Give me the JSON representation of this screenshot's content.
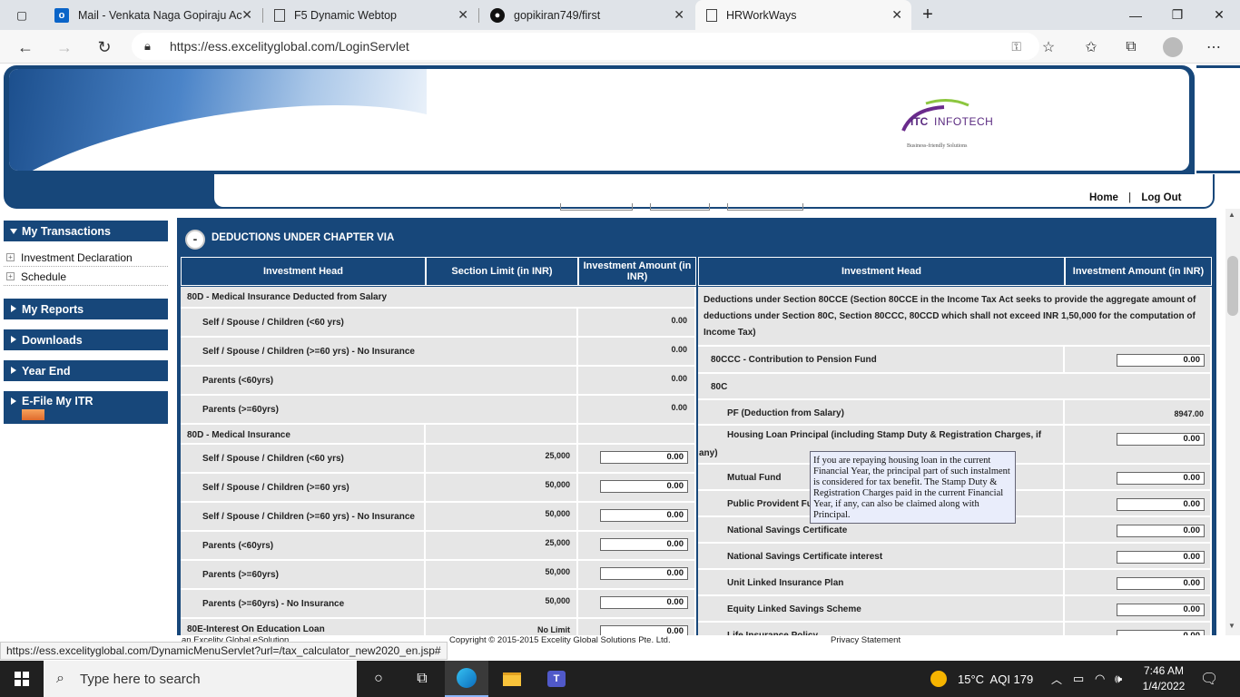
{
  "browser": {
    "tabs": [
      {
        "title": "Mail - Venkata Naga Gopiraju Ac",
        "icon": "outlook-icon"
      },
      {
        "title": "F5 Dynamic Webtop",
        "icon": "page-icon"
      },
      {
        "title": "gopikiran749/first",
        "icon": "github-icon"
      },
      {
        "title": "HRWorkWays",
        "icon": "page-icon"
      }
    ],
    "url": "https://ess.excelityglobal.com/LoginServlet"
  },
  "header": {
    "logo_text": "ITC INFOTECH",
    "logo_tagline": "Business-friendly Solutions",
    "home_link": "Home",
    "separator": "|",
    "logout_link": "Log Out"
  },
  "sidebar": {
    "my_transactions": "My Transactions",
    "investment_declaration": "Investment Declaration",
    "schedule": "Schedule",
    "my_reports": "My Reports",
    "downloads": "Downloads",
    "year_end": "Year End",
    "efile": "E-File My ITR"
  },
  "section": {
    "title": "DEDUCTIONS UNDER CHAPTER VIA",
    "left_headers": [
      "Investment Head",
      "Section Limit (in INR)",
      "Investment Amount (in INR)"
    ],
    "right_headers": [
      "Investment Head",
      "Investment Amount (in INR)"
    ],
    "left_rows": [
      {
        "label": "80D - Medical Insurance Deducted from Salary",
        "limit": "",
        "amount": ""
      },
      {
        "label": "Self / Spouse / Children (<60 yrs)",
        "limit": "",
        "amount": "0.00"
      },
      {
        "label": "Self / Spouse / Children (>=60 yrs) - No Insurance",
        "limit": "",
        "amount": "0.00"
      },
      {
        "label": "Parents (<60yrs)",
        "limit": "",
        "amount": "0.00"
      },
      {
        "label": "Parents (>=60yrs)",
        "limit": "",
        "amount": "0.00"
      },
      {
        "label": "80D - Medical Insurance",
        "limit": "",
        "amount": ""
      },
      {
        "label": "Self / Spouse / Children (<60 yrs)",
        "limit": "25,000",
        "amount": "0.00"
      },
      {
        "label": "Self / Spouse / Children (>=60 yrs)",
        "limit": "50,000",
        "amount": "0.00"
      },
      {
        "label": "Self / Spouse / Children (>=60 yrs) - No Insurance",
        "limit": "50,000",
        "amount": "0.00"
      },
      {
        "label": "Parents (<60yrs)",
        "limit": "25,000",
        "amount": "0.00"
      },
      {
        "label": "Parents (>=60yrs)",
        "limit": "50,000",
        "amount": "0.00"
      },
      {
        "label": "Parents (>=60yrs) - No Insurance",
        "limit": "50,000",
        "amount": "0.00"
      },
      {
        "label": "80E-Interest On Education Loan",
        "limit": "No Limit",
        "amount": "0.00"
      }
    ],
    "right_intro": "Deductions under Section 80CCE (Section 80CCE in the Income Tax Act seeks to provide the aggregate amount of deductions under Section 80C, Section 80CCC, 80CCD which shall not exceed INR 1,50,000 for the computation of Income Tax)",
    "right_rows": [
      {
        "label": "80CCC - Contribution to Pension Fund",
        "amount": "0.00"
      },
      {
        "label": "80C",
        "amount": ""
      },
      {
        "label": "PF (Deduction from Salary)",
        "amount": "8947.00"
      },
      {
        "label": "Housing Loan Principal (including Stamp Duty & Registration Charges, if",
        "label2": "any)",
        "amount": "0.00"
      },
      {
        "label": "Mutual Fund",
        "amount": "0.00"
      },
      {
        "label": "Public Provident Fu",
        "amount": "0.00"
      },
      {
        "label": "National Savings Certificate",
        "amount": "0.00"
      },
      {
        "label": "National Savings Certificate interest",
        "amount": "0.00"
      },
      {
        "label": "Unit Linked Insurance Plan",
        "amount": "0.00"
      },
      {
        "label": "Equity Linked Savings Scheme",
        "amount": "0.00"
      },
      {
        "label": "Life Insurance Policy",
        "amount": "0.00"
      }
    ],
    "tooltip": "If you are repaying housing loan in the current Financial Year, the principal part of such instalment is considered for tax benefit. The Stamp Duty & Registration Charges paid in the current Financial Year, if any, can also be claimed along with Principal."
  },
  "footer": {
    "left": "an Excelity Global eSolution",
    "copyright": "Copyright © 2015-2015 Excelity Global Solutions Pte. Ltd.",
    "privacy": "Privacy Statement"
  },
  "status_url": "https://ess.excelityglobal.com/DynamicMenuServlet?url=/tax_calculator_new2020_en.jsp#",
  "taskbar": {
    "search_placeholder": "Type here to search",
    "weather": "15°C  AQI 179",
    "time": "7:46 AM",
    "date": "1/4/2022"
  }
}
